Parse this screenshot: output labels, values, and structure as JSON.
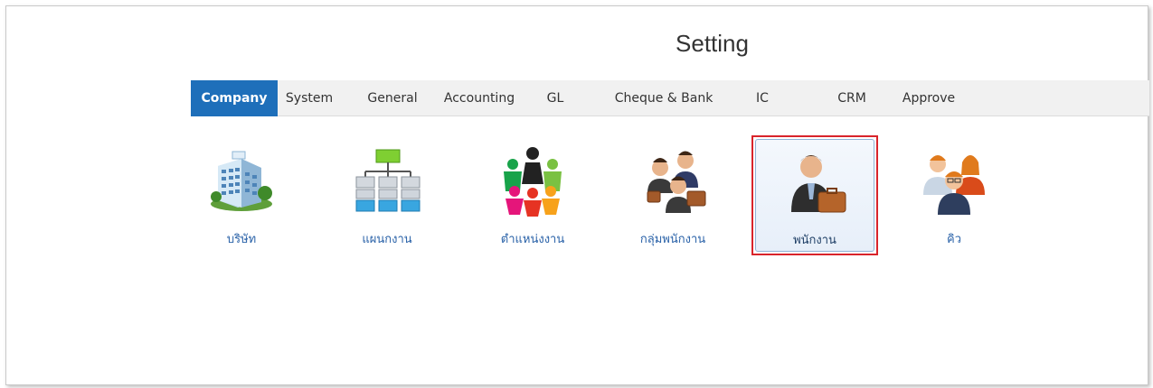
{
  "page": {
    "title": "Setting"
  },
  "tabs": [
    {
      "label": "Company",
      "active": true
    },
    {
      "label": "System",
      "active": false
    },
    {
      "label": "General",
      "active": false
    },
    {
      "label": "Accounting",
      "active": false
    },
    {
      "label": "GL",
      "active": false
    },
    {
      "label": "Cheque & Bank",
      "active": false
    },
    {
      "label": "IC",
      "active": false
    },
    {
      "label": "CRM",
      "active": false
    },
    {
      "label": "Approve",
      "active": false
    }
  ],
  "tiles": [
    {
      "label": "บริษัท",
      "icon": "company-building-icon"
    },
    {
      "label": "แผนกงาน",
      "icon": "org-chart-icon"
    },
    {
      "label": "ตำแหน่งงาน",
      "icon": "people-circle-icon"
    },
    {
      "label": "กลุ่มพนักงาน",
      "icon": "employee-group-icon"
    },
    {
      "label": "พนักงาน",
      "icon": "employee-icon",
      "selected": true
    },
    {
      "label": "คิว",
      "icon": "queue-people-icon"
    }
  ],
  "colors": {
    "accent": "#1e6fba",
    "highlight_border": "#d9242b",
    "tile_label": "#2a62a8"
  }
}
